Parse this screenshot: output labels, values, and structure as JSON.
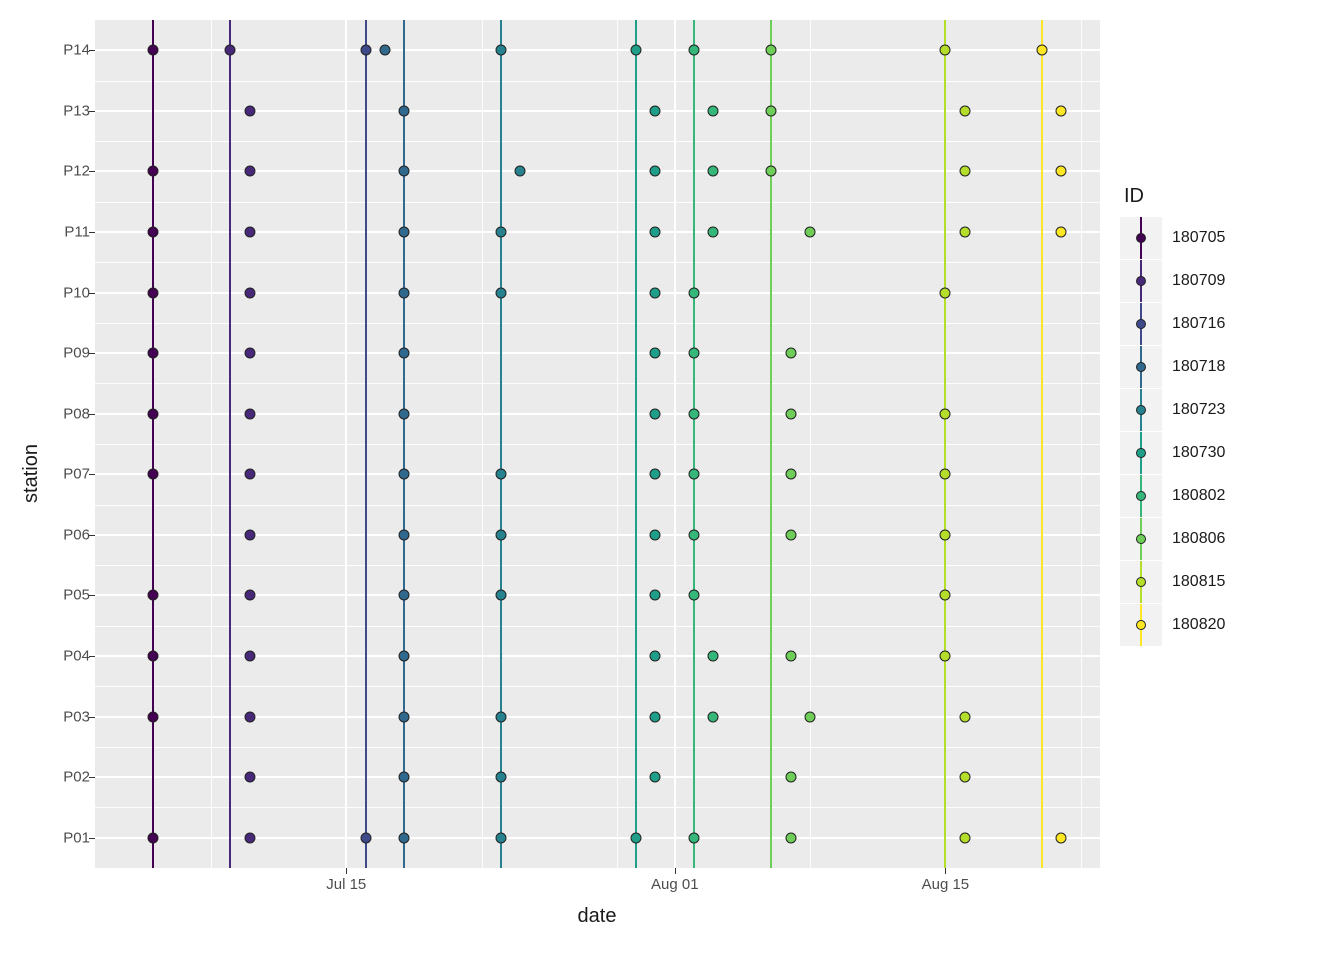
{
  "chart_data": {
    "type": "scatter",
    "xlabel": "date",
    "ylabel": "station",
    "x_start": "2018-07-02",
    "x_end": "2018-08-23",
    "x_ticks": [
      {
        "label": "Jul 15",
        "date": "2018-07-15"
      },
      {
        "label": "Aug 01",
        "date": "2018-08-01"
      },
      {
        "label": "Aug 15",
        "date": "2018-08-15"
      }
    ],
    "stations": [
      "P01",
      "P02",
      "P03",
      "P04",
      "P05",
      "P06",
      "P07",
      "P08",
      "P09",
      "P10",
      "P11",
      "P12",
      "P13",
      "P14"
    ],
    "legend_title": "ID",
    "ids": [
      {
        "id": "180705",
        "line_date": "2018-07-05",
        "color": "#440154"
      },
      {
        "id": "180709",
        "line_date": "2018-07-09",
        "color": "#482878"
      },
      {
        "id": "180716",
        "line_date": "2018-07-16",
        "color": "#3e4a89"
      },
      {
        "id": "180718",
        "line_date": "2018-07-18",
        "color": "#31688e"
      },
      {
        "id": "180723",
        "line_date": "2018-07-23",
        "color": "#26828e"
      },
      {
        "id": "180730",
        "line_date": "2018-07-30",
        "color": "#1f9e89"
      },
      {
        "id": "180802",
        "line_date": "2018-08-02",
        "color": "#35b779"
      },
      {
        "id": "180806",
        "line_date": "2018-08-06",
        "color": "#6ece58"
      },
      {
        "id": "180815",
        "line_date": "2018-08-15",
        "color": "#b5de2b"
      },
      {
        "id": "180820",
        "line_date": "2018-08-20",
        "color": "#fde725"
      }
    ],
    "points": [
      {
        "station": "P01",
        "date": "2018-07-05",
        "id": "180705"
      },
      {
        "station": "P03",
        "date": "2018-07-05",
        "id": "180705"
      },
      {
        "station": "P04",
        "date": "2018-07-05",
        "id": "180705"
      },
      {
        "station": "P05",
        "date": "2018-07-05",
        "id": "180705"
      },
      {
        "station": "P07",
        "date": "2018-07-05",
        "id": "180705"
      },
      {
        "station": "P08",
        "date": "2018-07-05",
        "id": "180705"
      },
      {
        "station": "P09",
        "date": "2018-07-05",
        "id": "180705"
      },
      {
        "station": "P10",
        "date": "2018-07-05",
        "id": "180705"
      },
      {
        "station": "P11",
        "date": "2018-07-05",
        "id": "180705"
      },
      {
        "station": "P12",
        "date": "2018-07-05",
        "id": "180705"
      },
      {
        "station": "P14",
        "date": "2018-07-05",
        "id": "180705"
      },
      {
        "station": "P01",
        "date": "2018-07-10",
        "id": "180709"
      },
      {
        "station": "P02",
        "date": "2018-07-10",
        "id": "180709"
      },
      {
        "station": "P03",
        "date": "2018-07-10",
        "id": "180709"
      },
      {
        "station": "P04",
        "date": "2018-07-10",
        "id": "180709"
      },
      {
        "station": "P05",
        "date": "2018-07-10",
        "id": "180709"
      },
      {
        "station": "P06",
        "date": "2018-07-10",
        "id": "180709"
      },
      {
        "station": "P07",
        "date": "2018-07-10",
        "id": "180709"
      },
      {
        "station": "P08",
        "date": "2018-07-10",
        "id": "180709"
      },
      {
        "station": "P09",
        "date": "2018-07-10",
        "id": "180709"
      },
      {
        "station": "P10",
        "date": "2018-07-10",
        "id": "180709"
      },
      {
        "station": "P11",
        "date": "2018-07-10",
        "id": "180709"
      },
      {
        "station": "P12",
        "date": "2018-07-10",
        "id": "180709"
      },
      {
        "station": "P13",
        "date": "2018-07-10",
        "id": "180709"
      },
      {
        "station": "P14",
        "date": "2018-07-09",
        "id": "180709"
      },
      {
        "station": "P01",
        "date": "2018-07-16",
        "id": "180716"
      },
      {
        "station": "P14",
        "date": "2018-07-16",
        "id": "180716"
      },
      {
        "station": "P01",
        "date": "2018-07-18",
        "id": "180718"
      },
      {
        "station": "P02",
        "date": "2018-07-18",
        "id": "180718"
      },
      {
        "station": "P03",
        "date": "2018-07-18",
        "id": "180718"
      },
      {
        "station": "P04",
        "date": "2018-07-18",
        "id": "180718"
      },
      {
        "station": "P05",
        "date": "2018-07-18",
        "id": "180718"
      },
      {
        "station": "P06",
        "date": "2018-07-18",
        "id": "180718"
      },
      {
        "station": "P07",
        "date": "2018-07-18",
        "id": "180718"
      },
      {
        "station": "P08",
        "date": "2018-07-18",
        "id": "180718"
      },
      {
        "station": "P09",
        "date": "2018-07-18",
        "id": "180718"
      },
      {
        "station": "P10",
        "date": "2018-07-18",
        "id": "180718"
      },
      {
        "station": "P11",
        "date": "2018-07-18",
        "id": "180718"
      },
      {
        "station": "P12",
        "date": "2018-07-18",
        "id": "180718"
      },
      {
        "station": "P13",
        "date": "2018-07-18",
        "id": "180718"
      },
      {
        "station": "P14",
        "date": "2018-07-17",
        "id": "180718"
      },
      {
        "station": "P01",
        "date": "2018-07-23",
        "id": "180723"
      },
      {
        "station": "P02",
        "date": "2018-07-23",
        "id": "180723"
      },
      {
        "station": "P03",
        "date": "2018-07-23",
        "id": "180723"
      },
      {
        "station": "P05",
        "date": "2018-07-23",
        "id": "180723"
      },
      {
        "station": "P06",
        "date": "2018-07-23",
        "id": "180723"
      },
      {
        "station": "P07",
        "date": "2018-07-23",
        "id": "180723"
      },
      {
        "station": "P10",
        "date": "2018-07-23",
        "id": "180723"
      },
      {
        "station": "P11",
        "date": "2018-07-23",
        "id": "180723"
      },
      {
        "station": "P12",
        "date": "2018-07-24",
        "id": "180723"
      },
      {
        "station": "P14",
        "date": "2018-07-23",
        "id": "180723"
      },
      {
        "station": "P01",
        "date": "2018-07-30",
        "id": "180730"
      },
      {
        "station": "P02",
        "date": "2018-07-31",
        "id": "180730"
      },
      {
        "station": "P03",
        "date": "2018-07-31",
        "id": "180730"
      },
      {
        "station": "P04",
        "date": "2018-07-31",
        "id": "180730"
      },
      {
        "station": "P05",
        "date": "2018-07-31",
        "id": "180730"
      },
      {
        "station": "P06",
        "date": "2018-07-31",
        "id": "180730"
      },
      {
        "station": "P07",
        "date": "2018-07-31",
        "id": "180730"
      },
      {
        "station": "P08",
        "date": "2018-07-31",
        "id": "180730"
      },
      {
        "station": "P09",
        "date": "2018-07-31",
        "id": "180730"
      },
      {
        "station": "P10",
        "date": "2018-07-31",
        "id": "180730"
      },
      {
        "station": "P11",
        "date": "2018-07-31",
        "id": "180730"
      },
      {
        "station": "P12",
        "date": "2018-07-31",
        "id": "180730"
      },
      {
        "station": "P13",
        "date": "2018-07-31",
        "id": "180730"
      },
      {
        "station": "P14",
        "date": "2018-07-30",
        "id": "180730"
      },
      {
        "station": "P01",
        "date": "2018-08-02",
        "id": "180802"
      },
      {
        "station": "P03",
        "date": "2018-08-03",
        "id": "180802"
      },
      {
        "station": "P04",
        "date": "2018-08-03",
        "id": "180802"
      },
      {
        "station": "P05",
        "date": "2018-08-02",
        "id": "180802"
      },
      {
        "station": "P06",
        "date": "2018-08-02",
        "id": "180802"
      },
      {
        "station": "P07",
        "date": "2018-08-02",
        "id": "180802"
      },
      {
        "station": "P08",
        "date": "2018-08-02",
        "id": "180802"
      },
      {
        "station": "P09",
        "date": "2018-08-02",
        "id": "180802"
      },
      {
        "station": "P10",
        "date": "2018-08-02",
        "id": "180802"
      },
      {
        "station": "P11",
        "date": "2018-08-03",
        "id": "180802"
      },
      {
        "station": "P12",
        "date": "2018-08-03",
        "id": "180802"
      },
      {
        "station": "P13",
        "date": "2018-08-03",
        "id": "180802"
      },
      {
        "station": "P14",
        "date": "2018-08-02",
        "id": "180802"
      },
      {
        "station": "P01",
        "date": "2018-08-07",
        "id": "180806"
      },
      {
        "station": "P02",
        "date": "2018-08-07",
        "id": "180806"
      },
      {
        "station": "P03",
        "date": "2018-08-08",
        "id": "180806"
      },
      {
        "station": "P04",
        "date": "2018-08-07",
        "id": "180806"
      },
      {
        "station": "P06",
        "date": "2018-08-07",
        "id": "180806"
      },
      {
        "station": "P07",
        "date": "2018-08-07",
        "id": "180806"
      },
      {
        "station": "P08",
        "date": "2018-08-07",
        "id": "180806"
      },
      {
        "station": "P09",
        "date": "2018-08-07",
        "id": "180806"
      },
      {
        "station": "P11",
        "date": "2018-08-08",
        "id": "180806"
      },
      {
        "station": "P12",
        "date": "2018-08-06",
        "id": "180806"
      },
      {
        "station": "P13",
        "date": "2018-08-06",
        "id": "180806"
      },
      {
        "station": "P14",
        "date": "2018-08-06",
        "id": "180806"
      },
      {
        "station": "P01",
        "date": "2018-08-16",
        "id": "180815"
      },
      {
        "station": "P02",
        "date": "2018-08-16",
        "id": "180815"
      },
      {
        "station": "P03",
        "date": "2018-08-16",
        "id": "180815"
      },
      {
        "station": "P04",
        "date": "2018-08-15",
        "id": "180815"
      },
      {
        "station": "P05",
        "date": "2018-08-15",
        "id": "180815"
      },
      {
        "station": "P06",
        "date": "2018-08-15",
        "id": "180815"
      },
      {
        "station": "P07",
        "date": "2018-08-15",
        "id": "180815"
      },
      {
        "station": "P08",
        "date": "2018-08-15",
        "id": "180815"
      },
      {
        "station": "P10",
        "date": "2018-08-15",
        "id": "180815"
      },
      {
        "station": "P11",
        "date": "2018-08-16",
        "id": "180815"
      },
      {
        "station": "P12",
        "date": "2018-08-16",
        "id": "180815"
      },
      {
        "station": "P13",
        "date": "2018-08-16",
        "id": "180815"
      },
      {
        "station": "P14",
        "date": "2018-08-15",
        "id": "180815"
      },
      {
        "station": "P01",
        "date": "2018-08-21",
        "id": "180820"
      },
      {
        "station": "P11",
        "date": "2018-08-21",
        "id": "180820"
      },
      {
        "station": "P12",
        "date": "2018-08-21",
        "id": "180820"
      },
      {
        "station": "P13",
        "date": "2018-08-21",
        "id": "180820"
      },
      {
        "station": "P14",
        "date": "2018-08-20",
        "id": "180820"
      }
    ]
  }
}
